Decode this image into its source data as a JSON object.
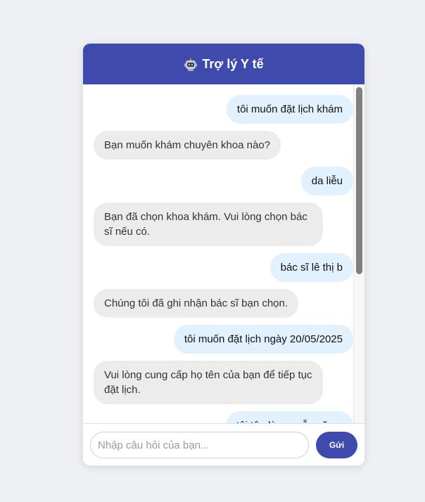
{
  "header": {
    "icon": "robot-icon",
    "title": "Trợ lý Y tế"
  },
  "messages": [
    {
      "sender": "user",
      "text": "tôi muốn đặt lịch khám"
    },
    {
      "sender": "bot",
      "text": "Bạn muốn khám chuyên khoa nào?"
    },
    {
      "sender": "user",
      "text": "da liễu"
    },
    {
      "sender": "bot",
      "text": "Bạn đã chọn khoa khám. Vui lòng chọn bác sĩ nếu có."
    },
    {
      "sender": "user",
      "text": "bác sĩ lê thị b"
    },
    {
      "sender": "bot",
      "text": "Chúng tôi đã ghi nhận bác sĩ bạn chọn."
    },
    {
      "sender": "user",
      "text": "tôi muốn đặt lịch ngày 20/05/2025"
    },
    {
      "sender": "bot",
      "text": "Vui lòng cung cấp họ tên của bạn để tiếp tục đặt lịch."
    },
    {
      "sender": "user",
      "text": "tôi tên là nguyễn văn a"
    }
  ],
  "input": {
    "placeholder": "Nhập câu hỏi của bạn...",
    "value": ""
  },
  "send_button": {
    "label": "Gửi"
  },
  "colors": {
    "primary": "#3f4aad",
    "user_bubble": "#e1f1fd",
    "bot_bubble": "#ececec",
    "page_background": "#eef0f3"
  }
}
